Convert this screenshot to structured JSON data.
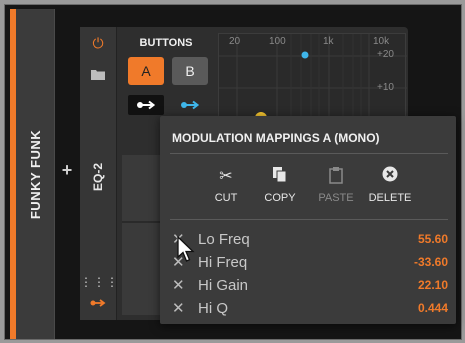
{
  "track": {
    "name": "FUNKY FUNK"
  },
  "add_label": "+",
  "device": {
    "name": "EQ-2",
    "panel_title": "BUTTONS",
    "button_a": "A",
    "button_b": "B"
  },
  "eq_display": {
    "freq_labels": [
      "20",
      "100",
      "1k",
      "10k"
    ],
    "gain_labels": [
      "+20",
      "+10"
    ]
  },
  "popup": {
    "title": "MODULATION MAPPINGS A (MONO)",
    "actions": [
      {
        "label": "CUT",
        "icon": "scissors-icon",
        "enabled": true
      },
      {
        "label": "COPY",
        "icon": "copy-icon",
        "enabled": true
      },
      {
        "label": "PASTE",
        "icon": "paste-icon",
        "enabled": false
      },
      {
        "label": "DELETE",
        "icon": "delete-icon",
        "enabled": true
      }
    ],
    "mappings": [
      {
        "name": "Lo Freq",
        "value": "55.60"
      },
      {
        "name": "Hi Freq",
        "value": "-33.60"
      },
      {
        "name": "Hi Gain",
        "value": "22.10"
      },
      {
        "name": "Hi Q",
        "value": "0.444"
      }
    ]
  },
  "colors": {
    "accent": "#f07a2a",
    "blue": "#3fb6ea",
    "yellow": "#f4c430"
  }
}
